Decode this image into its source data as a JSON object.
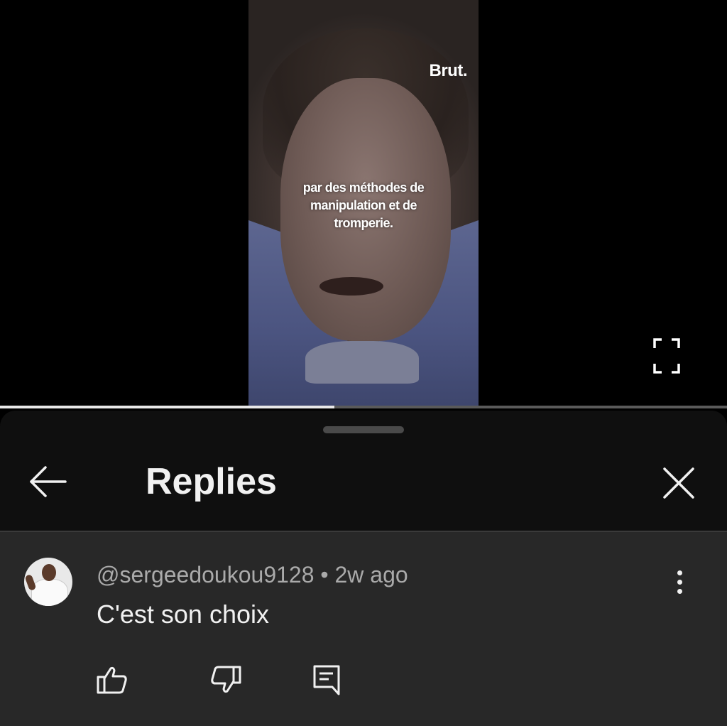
{
  "video": {
    "brand_logo": "Brut.",
    "subtitle_lines": [
      "par des méthodes de",
      "manipulation et de",
      "tromperie."
    ],
    "progress": 0.46
  },
  "icons": {
    "fullscreen": "fullscreen-icon",
    "back": "arrow-left-icon",
    "close": "close-icon",
    "more": "more-vert-icon",
    "like": "thumb-up-icon",
    "dislike": "thumb-down-icon",
    "reply": "comment-reply-icon"
  },
  "sheet": {
    "title": "Replies"
  },
  "comment": {
    "author": "@sergeedoukou9128",
    "separator": "•",
    "time": "2w ago",
    "text": "C'est son choix"
  },
  "colors": {
    "sheet_bg": "#0f0f0f",
    "comment_bg": "#282828",
    "meta_text": "#aaaaaa",
    "primary_text": "#f1f1f1",
    "progress_fill": "#e8e8e8"
  }
}
